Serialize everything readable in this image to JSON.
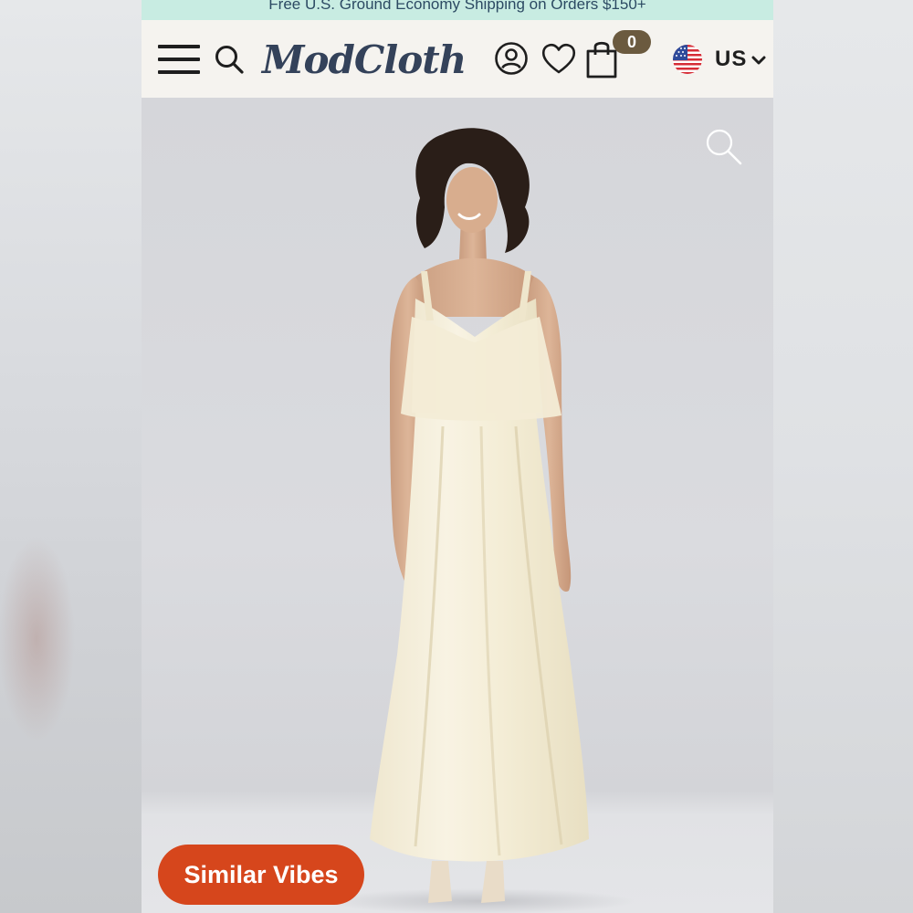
{
  "promo": {
    "text": "Free U.S. Ground Economy Shipping on Orders $150+"
  },
  "header": {
    "menu_icon": "hamburger-menu-icon",
    "search_icon": "search-icon",
    "logo_text": "ModCloth",
    "account_icon": "user-account-icon",
    "wishlist_icon": "heart-icon",
    "bag_icon": "shopping-bag-icon",
    "bag_count": "0",
    "locale_flag": "us-flag-icon",
    "locale_label": "US"
  },
  "product_image": {
    "zoom_icon": "zoom-icon"
  },
  "similar_button": {
    "label": "Similar Vibes"
  },
  "colors": {
    "promo_bg": "#c8ece2",
    "header_bg": "#f5f3ef",
    "logo": "#34425a",
    "bag_badge": "#6b5a3f",
    "accent_button": "#d6461c"
  }
}
